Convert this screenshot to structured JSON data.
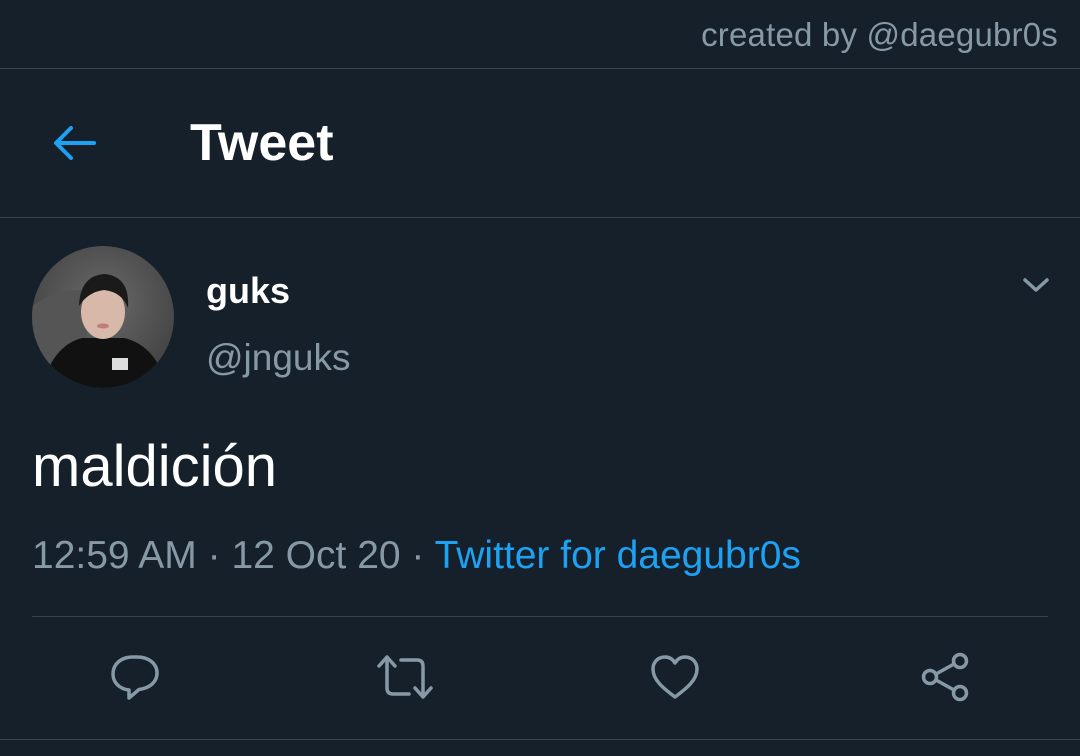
{
  "watermark": "created by @daegubr0s",
  "header": {
    "title": "Tweet",
    "back_icon": "arrow-left-icon"
  },
  "tweet": {
    "author": {
      "display_name": "guks",
      "handle": "@jnguks",
      "avatar": "avatar-photo"
    },
    "text": "maldición",
    "time": "12:59 AM",
    "date": "12 Oct 20",
    "separator": "·",
    "source": "Twitter for daegubr0s"
  },
  "actions": [
    {
      "name": "reply",
      "icon": "reply-icon"
    },
    {
      "name": "retweet",
      "icon": "retweet-icon"
    },
    {
      "name": "like",
      "icon": "heart-icon"
    },
    {
      "name": "share",
      "icon": "share-icon"
    }
  ],
  "colors": {
    "background": "#15202b",
    "accent": "#1da1f2",
    "secondary_text": "#8899a6",
    "divider": "#38444d",
    "icon": "#8899a6"
  }
}
